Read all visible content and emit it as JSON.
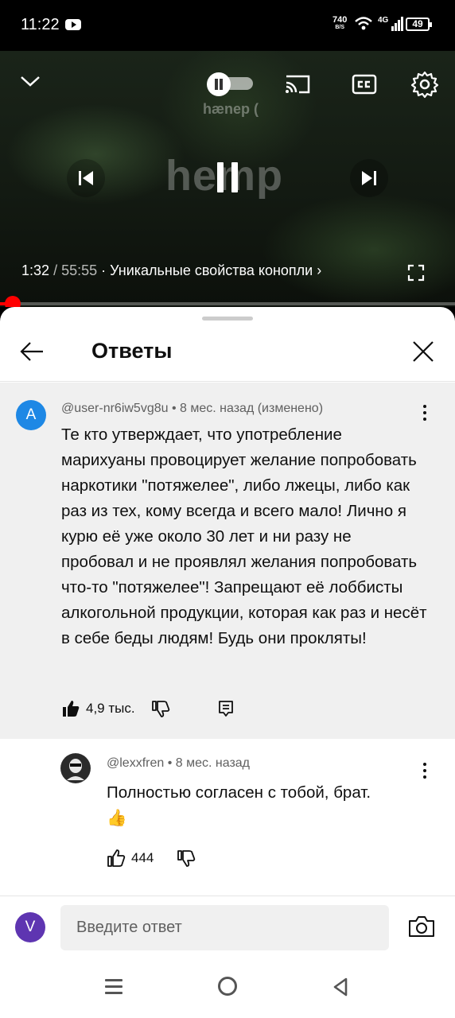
{
  "status_bar": {
    "time": "11:22",
    "net_speed": "740",
    "net_unit": "B/S",
    "network": "4G",
    "battery": "49"
  },
  "player": {
    "watermark": "hemp",
    "watermark_small": "hænep (",
    "current_time": "1:32",
    "separator": "/",
    "duration": "55:55",
    "chapter": "· Уникальные свойства конопли ›",
    "progress": 0.0276,
    "accent_color": "#ff0000"
  },
  "sheet": {
    "title": "Ответы"
  },
  "main_comment": {
    "avatar_letter": "A",
    "avatar_color": "#1e88e5",
    "author": "@user-nr6iw5vg8u",
    "meta": "@user-nr6iw5vg8u • 8 мес. назад (изменено)",
    "text": "Те кто утверждает, что употребление марихуаны провоцирует желание попробовать наркотики \"потяжелее\", либо лжецы, либо как раз из тех, кому всегда и всего мало! Лично я курю её уже около 30 лет и ни разу не пробовал и не проявлял желания попробовать что-то \"потяжелее\"! Запрещают её лоббисты алкогольной продукции, которая как раз и несёт в себе беды людям! Будь они прокляты!",
    "likes": "4,9 тыс."
  },
  "reply": {
    "meta": "@lexxfren • 8 мес. назад",
    "text": "Полностью согласен с тобой, брат.",
    "emoji": "👍",
    "likes": "444"
  },
  "composer": {
    "avatar_letter": "V",
    "avatar_color": "#5e35b1",
    "placeholder": "Введите ответ"
  },
  "icons": [
    "chevron-down-icon",
    "autoplay-toggle-icon",
    "cast-icon",
    "cc-icon",
    "settings-icon",
    "previous-icon",
    "pause-icon",
    "next-icon",
    "fullscreen-icon",
    "back-arrow-icon",
    "close-icon",
    "more-icon",
    "like-icon",
    "dislike-icon",
    "reply-icon",
    "camera-icon",
    "menu-icon",
    "home-icon",
    "nav-back-icon"
  ]
}
